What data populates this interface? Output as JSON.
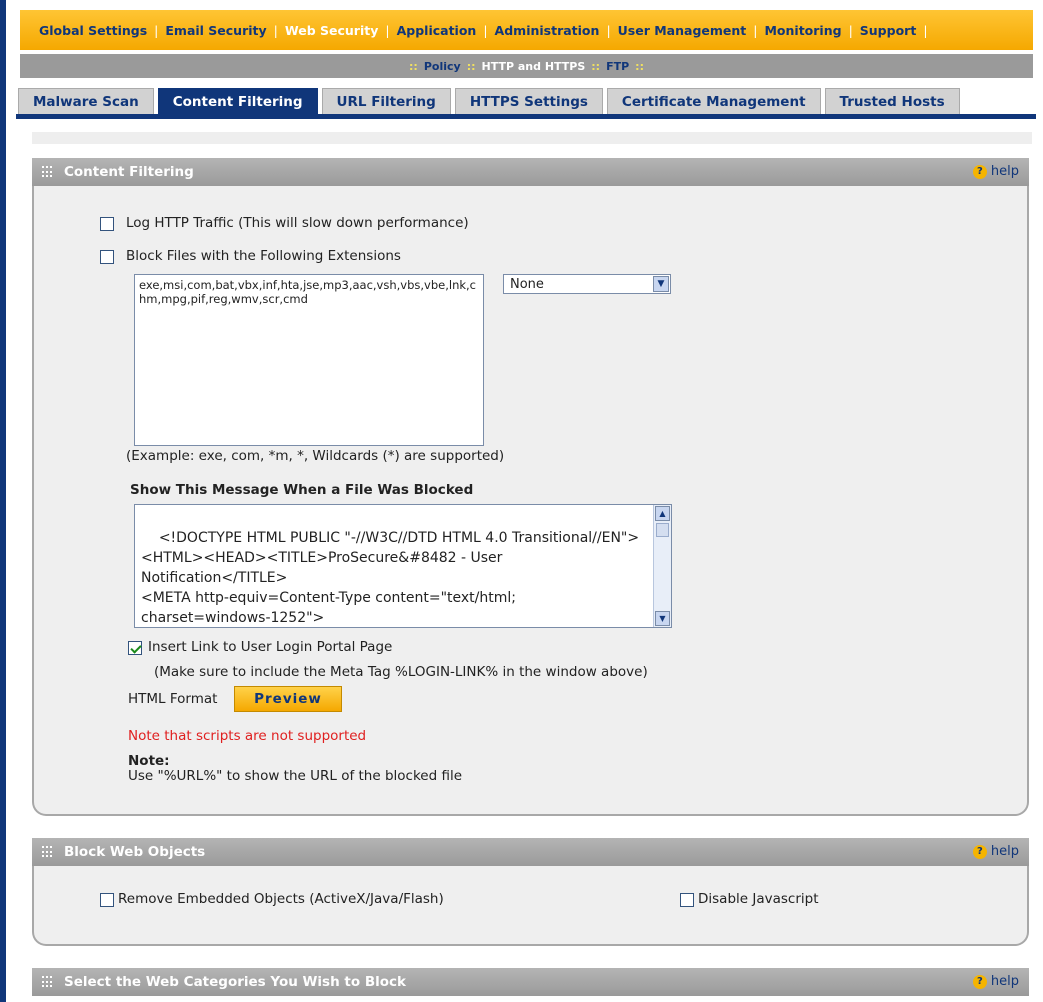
{
  "top_nav": {
    "items": [
      "Global Settings",
      "Email Security",
      "Web Security",
      "Application",
      "Administration",
      "User Management",
      "Monitoring",
      "Support"
    ],
    "separator": "|"
  },
  "sub_nav": {
    "sep": "::",
    "items": [
      "Policy",
      "HTTP and HTTPS",
      "FTP"
    ]
  },
  "tabs": [
    "Malware Scan",
    "Content Filtering",
    "URL Filtering",
    "HTTPS Settings",
    "Certificate Management",
    "Trusted Hosts"
  ],
  "content_filtering": {
    "title": "Content Filtering",
    "help": "help",
    "log_http_label": "Log HTTP Traffic (This will slow down performance)",
    "block_ext_label": "Block Files with the Following Extensions",
    "extensions_value": "exe,msi,com,bat,vbx,inf,hta,jse,mp3,aac,vsh,vbs,vbe,lnk,chm,mpg,pif,reg,wmv,scr,cmd",
    "preset_select": "None",
    "example_text": "(Example: exe, com, *m, *, Wildcards (*) are supported)",
    "message_heading": "Show This Message When a File Was Blocked",
    "message_value": "<!DOCTYPE HTML PUBLIC \"-//W3C//DTD HTML 4.0 Transitional//EN\">\n<HTML><HEAD><TITLE>ProSecure&#8482 - User Notification</TITLE>\n<META http-equiv=Content-Type content=\"text/html; charset=windows-1252\">",
    "insert_link_label": "Insert Link to User Login Portal Page",
    "insert_link_checked": true,
    "meta_tag_note": "(Make sure to include the Meta Tag %LOGIN-LINK% in the window above)",
    "html_format_label": "HTML Format",
    "preview_label": "Preview",
    "scripts_note": "Note that scripts are not supported",
    "note_title": "Note:",
    "note_text": "Use \"%URL%\" to show the URL of the blocked file"
  },
  "block_web_objects": {
    "title": "Block Web Objects",
    "help": "help",
    "remove_embedded_label": "Remove Embedded Objects (ActiveX/Java/Flash)",
    "disable_js_label": "Disable Javascript"
  },
  "web_categories": {
    "title": "Select the Web Categories You Wish to Block",
    "help": "help"
  },
  "colors": {
    "nav_orange": "#f5a800",
    "nav_blue": "#10367a",
    "header_gray": "#9a9a9a",
    "note_red": "#e02020"
  }
}
